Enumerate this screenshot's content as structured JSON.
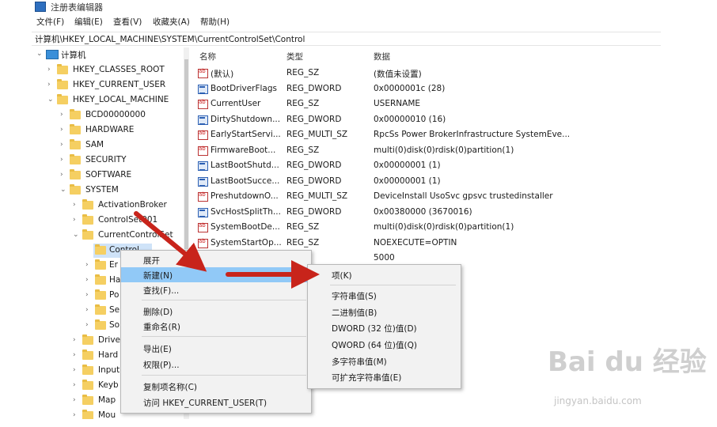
{
  "window": {
    "title": "注册表编辑器"
  },
  "menu": [
    "文件(F)",
    "编辑(E)",
    "查看(V)",
    "收藏夹(A)",
    "帮助(H)"
  ],
  "address": "计算机\\HKEY_LOCAL_MACHINE\\SYSTEM\\CurrentControlSet\\Control",
  "tree": [
    {
      "label": "计算机",
      "icon": "computer-icon"
    },
    {
      "label": "HKEY_CLASSES_ROOT"
    },
    {
      "label": "HKEY_CURRENT_USER"
    },
    {
      "label": "HKEY_LOCAL_MACHINE"
    },
    {
      "label": "BCD00000000"
    },
    {
      "label": "HARDWARE"
    },
    {
      "label": "SAM"
    },
    {
      "label": "SECURITY"
    },
    {
      "label": "SOFTWARE"
    },
    {
      "label": "SYSTEM"
    },
    {
      "label": "ActivationBroker"
    },
    {
      "label": "ControlSet001"
    },
    {
      "label": "CurrentControlSet"
    },
    {
      "label": "Control"
    },
    {
      "label": "Er"
    },
    {
      "label": "Ha"
    },
    {
      "label": "Po"
    },
    {
      "label": "Se"
    },
    {
      "label": "So"
    },
    {
      "label": "Drive"
    },
    {
      "label": "Hard"
    },
    {
      "label": "Input"
    },
    {
      "label": "Keyb"
    },
    {
      "label": "Map"
    },
    {
      "label": "Mou"
    }
  ],
  "list": {
    "headers": [
      "名称",
      "类型",
      "数据"
    ],
    "rows": [
      {
        "name": "(默认)",
        "type": "REG_SZ",
        "data": "(数值未设置)",
        "icon": "string-value-icon"
      },
      {
        "name": "BootDriverFlags",
        "type": "REG_DWORD",
        "data": "0x0000001c (28)",
        "icon": "dword-value-icon"
      },
      {
        "name": "CurrentUser",
        "type": "REG_SZ",
        "data": "USERNAME",
        "icon": "string-value-icon"
      },
      {
        "name": "DirtyShutdown...",
        "type": "REG_DWORD",
        "data": "0x00000010 (16)",
        "icon": "dword-value-icon"
      },
      {
        "name": "EarlyStartServi...",
        "type": "REG_MULTI_SZ",
        "data": "RpcSs Power BrokerInfrastructure SystemEve...",
        "icon": "string-value-icon"
      },
      {
        "name": "FirmwareBoot...",
        "type": "REG_SZ",
        "data": "multi(0)disk(0)rdisk(0)partition(1)",
        "icon": "string-value-icon"
      },
      {
        "name": "LastBootShutd...",
        "type": "REG_DWORD",
        "data": "0x00000001 (1)",
        "icon": "dword-value-icon"
      },
      {
        "name": "LastBootSucce...",
        "type": "REG_DWORD",
        "data": "0x00000001 (1)",
        "icon": "dword-value-icon"
      },
      {
        "name": "PreshutdownO...",
        "type": "REG_MULTI_SZ",
        "data": "DeviceInstall UsoSvc gpsvc trustedinstaller",
        "icon": "string-value-icon"
      },
      {
        "name": "SvcHostSplitTh...",
        "type": "REG_DWORD",
        "data": "0x00380000 (3670016)",
        "icon": "dword-value-icon"
      },
      {
        "name": "SystemBootDe...",
        "type": "REG_SZ",
        "data": "multi(0)disk(0)rdisk(0)partition(1)",
        "icon": "string-value-icon"
      },
      {
        "name": "SystemStartOp...",
        "type": "REG_SZ",
        "data": "NOEXECUTE=OPTIN",
        "icon": "string-value-icon"
      },
      {
        "name": "",
        "type": "SZ",
        "data": "5000",
        "icon": ""
      }
    ]
  },
  "context_menu": {
    "items": [
      "展开",
      "新建(N)",
      "查找(F)...",
      "删除(D)",
      "重命名(R)",
      "导出(E)",
      "权限(P)...",
      "复制项名称(C)",
      "访问 HKEY_CURRENT_USER(T)"
    ],
    "highlighted": "新建(N)"
  },
  "submenu": {
    "items": [
      "项(K)",
      "字符串值(S)",
      "二进制值(B)",
      "DWORD (32 位)值(D)",
      "QWORD (64 位)值(Q)",
      "多字符串值(M)",
      "可扩充字符串值(E)"
    ]
  },
  "watermark": {
    "logo": "Bai du 经验",
    "url": "jingyan.baidu.com"
  },
  "colors": {
    "highlight": "#91c9f7",
    "selected": "#cfe3f8",
    "arrow": "#c8241b",
    "folder": "#f5cf62"
  }
}
